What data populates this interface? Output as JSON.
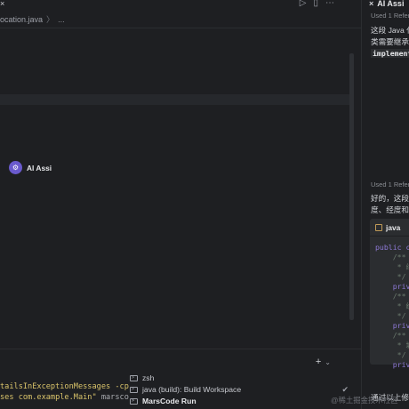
{
  "editor": {
    "tab_close": "×",
    "tab_actions": [
      "▷",
      "▯",
      "⋯"
    ],
    "breadcrumb": {
      "file": "ocation.java",
      "sep": "〉",
      "ellipsis": "..."
    }
  },
  "terminal": {
    "toolbar": {
      "add": "+",
      "chevron": "⌄"
    },
    "lines": [
      {
        "yellow": "tailsInExceptionMessages -cp",
        "grey": ""
      },
      {
        "yellow": "ses com.example.Main\"",
        "grey": " marsco"
      }
    ],
    "sessions": [
      {
        "label": "zsh",
        "active": false,
        "check": ""
      },
      {
        "label": "java (build): Build Workspace",
        "active": false,
        "check": "✔"
      },
      {
        "label": "MarsCode Run",
        "active": true,
        "check": ""
      }
    ]
  },
  "ai_panel": {
    "header": {
      "close": "×",
      "title": "AI Assi"
    },
    "first": {
      "refs": "Used 1 Refere",
      "lines": [
        "这段 Java 代",
        "类需要继承其"
      ],
      "code_word": "implement"
    },
    "second": {
      "avatar": "⚙",
      "name": "AI Assi",
      "refs": "Used 1 Refere",
      "lines": [
        "好的，这段代",
        "度、经度和城"
      ]
    },
    "code_block": {
      "lang": "java",
      "lines": [
        {
          "cls": "kw",
          "text": "public c"
        },
        {
          "cls": "cm",
          "text": "    /**"
        },
        {
          "cls": "cm",
          "text": "     * 纬"
        },
        {
          "cls": "cm",
          "text": "     */"
        },
        {
          "cls": "kw",
          "text": "    priv"
        },
        {
          "cls": "cm",
          "text": "    /**"
        },
        {
          "cls": "cm",
          "text": "     * 经"
        },
        {
          "cls": "cm",
          "text": "     */"
        },
        {
          "cls": "kw",
          "text": "    priv"
        },
        {
          "cls": "cm",
          "text": "    /**"
        },
        {
          "cls": "cm",
          "text": "     * 城"
        },
        {
          "cls": "cm",
          "text": "     */"
        },
        {
          "cls": "kw",
          "text": "    priv"
        }
      ]
    },
    "footer_text": "通过以上修改"
  },
  "watermark": "@稀土掘金技术社区"
}
